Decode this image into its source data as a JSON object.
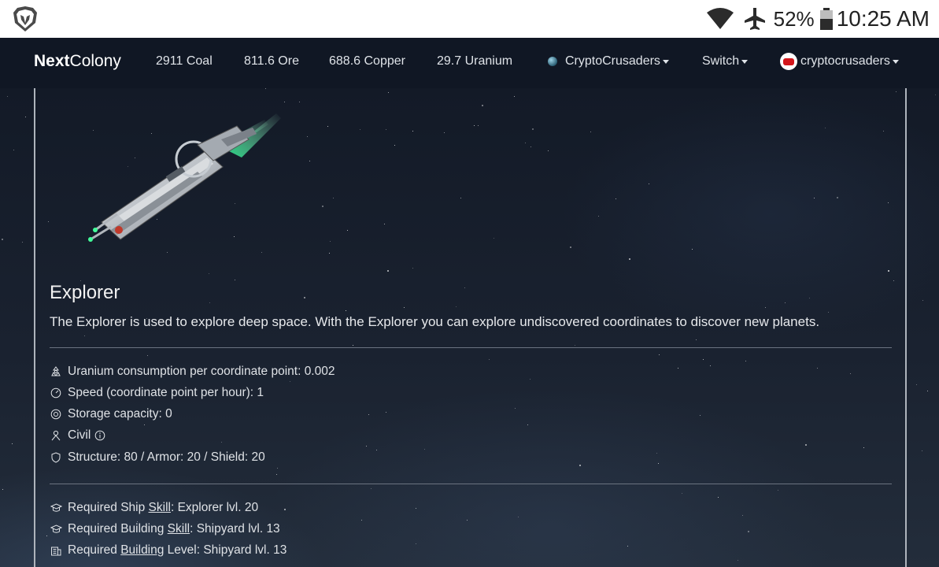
{
  "statusbar": {
    "battery_pct": "52%",
    "time": "10:25 AM",
    "icons": [
      "brave-lion-icon",
      "wifi-icon",
      "airplane-icon",
      "battery-icon"
    ]
  },
  "navbar": {
    "brand_bold": "Next",
    "brand_rest": "Colony",
    "resources": {
      "coal": "2911 Coal",
      "ore": "811.6 Ore",
      "copper": "688.6 Copper",
      "uranium": "29.7 Uranium"
    },
    "planet": "CryptoCrusaders",
    "switch": "Switch",
    "user": "cryptocrusaders"
  },
  "ship": {
    "name": "Explorer",
    "description": "The Explorer is used to explore deep space. With the Explorer you can explore undiscovered coordinates to discover new planets.",
    "specs": {
      "uranium": "Uranium consumption per coordinate point: 0.002",
      "speed": "Speed (coordinate point per hour): 1",
      "storage": "Storage capacity: 0",
      "type": "Civil",
      "stats": "Structure: 80 / Armor: 20 / Shield: 20"
    },
    "requirements": {
      "ship_skill_pre": "Required Ship ",
      "ship_skill_link": "Skill",
      "ship_skill_post": ": Explorer lvl. 20",
      "building_skill_pre": "Required Building ",
      "building_skill_link": "Skill",
      "building_skill_post": ": Shipyard lvl. 13",
      "building_level_pre": "Required ",
      "building_level_link": "Building",
      "building_level_post": " Level: Shipyard lvl. 13"
    }
  }
}
